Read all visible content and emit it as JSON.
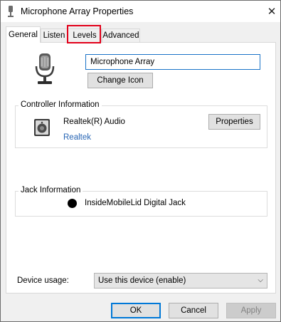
{
  "window": {
    "title": "Microphone Array Properties",
    "close_symbol": "✕"
  },
  "tabs": [
    {
      "label": "General",
      "active": true
    },
    {
      "label": "Listen",
      "active": false
    },
    {
      "label": "Levels",
      "active": false,
      "highlighted": true
    },
    {
      "label": "Advanced",
      "active": false
    }
  ],
  "general": {
    "device_name_value": "Microphone Array",
    "change_icon_label": "Change Icon",
    "device_icon": "microphone-icon"
  },
  "controller": {
    "group_label": "Controller Information",
    "name": "Realtek(R) Audio",
    "link": "Realtek",
    "properties_label": "Properties",
    "icon": "speaker-icon"
  },
  "jack": {
    "group_label": "Jack Information",
    "name": "InsideMobileLid Digital Jack"
  },
  "usage": {
    "label": "Device usage:",
    "selected": "Use this device (enable)"
  },
  "footer": {
    "ok_label": "OK",
    "cancel_label": "Cancel",
    "apply_label": "Apply"
  },
  "colors": {
    "highlight": "#e2001a",
    "link": "#2765b4",
    "focus": "#0078d7"
  }
}
